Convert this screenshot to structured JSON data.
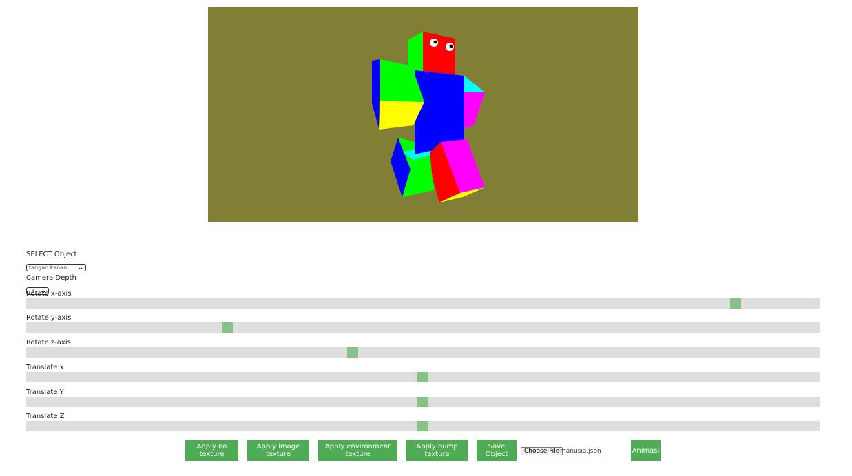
{
  "viewport": {
    "background": "#807f35",
    "scene": "3D blocky humanoid robot figure"
  },
  "controls": {
    "select_object_label": "SELECT Object",
    "select_object_value": "tangan kanan",
    "camera_depth_label": "Camera Depth",
    "camera_depth_value": "-3",
    "sliders": [
      {
        "label": "Rotate x-axis",
        "value_fraction": 0.9
      },
      {
        "label": "Rotate y-axis",
        "value_fraction": 0.25
      },
      {
        "label": "Rotate z-axis",
        "value_fraction": 0.41
      },
      {
        "label": "Translate x",
        "value_fraction": 0.5
      },
      {
        "label": "Translate Y",
        "value_fraction": 0.5
      },
      {
        "label": "Translate Z",
        "value_fraction": 0.5
      }
    ]
  },
  "buttons": {
    "no_texture": "Apply no texture",
    "image_texture": "Apply image texture",
    "environment_texture": "Apply environment texture",
    "bump_texture": "Apply bump texture",
    "save_object": "Save Object",
    "choose_file": "Choose File",
    "file_name": "manusia.json",
    "animasi": "Animasi"
  },
  "colors": {
    "button": "#4ead54",
    "slider_track": "#dedede",
    "slider_thumb": "#85c285"
  }
}
